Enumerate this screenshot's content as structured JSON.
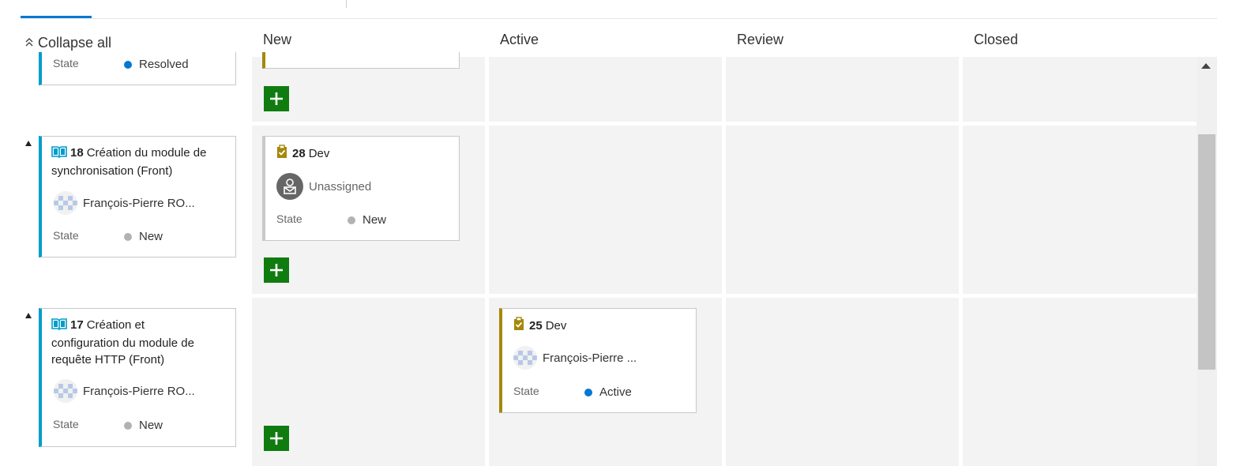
{
  "header": {
    "collapse_all": "Collapse all"
  },
  "columns": [
    {
      "label": "New"
    },
    {
      "label": "Active"
    },
    {
      "label": "Review"
    },
    {
      "label": "Closed"
    }
  ],
  "rows": [
    {
      "story": {
        "state_label": "State",
        "state_value": "Resolved",
        "state_color": "#0078d4"
      }
    },
    {
      "story": {
        "id": "18",
        "title": "Création du module de synchronisation (Front)",
        "assignee": "François-Pierre RO...",
        "state_label": "State",
        "state_value": "New",
        "state_color": "#b2b2b2",
        "icon": "book-icon"
      },
      "task": {
        "id": "28",
        "title": "Dev",
        "assignee": "Unassigned",
        "state_label": "State",
        "state_value": "New",
        "state_color": "#b2b2b2",
        "icon": "clipboard-check-icon"
      }
    },
    {
      "story": {
        "id": "17",
        "title_line1": "Création et",
        "title_line2": "configuration du module de",
        "title_line3": "requête HTTP (Front)",
        "assignee": "François-Pierre RO...",
        "state_label": "State",
        "state_value": "New",
        "state_color": "#b2b2b2",
        "icon": "book-icon"
      },
      "task": {
        "id": "25",
        "title": "Dev",
        "assignee": "François-Pierre ...",
        "state_label": "State",
        "state_value": "Active",
        "state_color": "#0078d4",
        "icon": "clipboard-check-icon"
      }
    }
  ],
  "colors": {
    "story_accent": "#009ccc",
    "task_accent": "#a4880a",
    "add_button": "#107c10",
    "cell_bg": "#f3f3f3"
  }
}
